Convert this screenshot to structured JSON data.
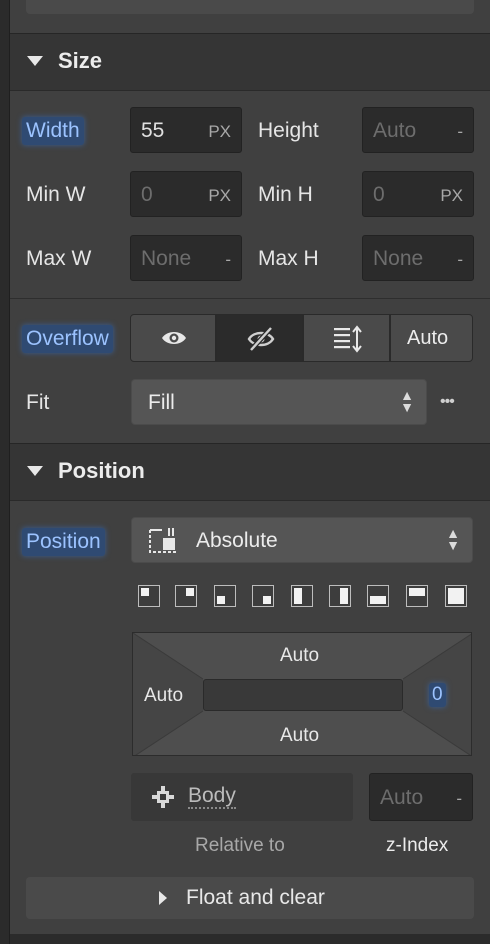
{
  "size": {
    "title": "Size",
    "width_label": "Width",
    "width_value": "55",
    "width_unit": "PX",
    "height_label": "Height",
    "height_value": "Auto",
    "height_unit": "-",
    "minw_label": "Min W",
    "minw_value": "0",
    "minw_unit": "PX",
    "minh_label": "Min H",
    "minh_value": "0",
    "minh_unit": "PX",
    "maxw_label": "Max W",
    "maxw_value": "None",
    "maxw_unit": "-",
    "maxh_label": "Max H",
    "maxh_value": "None",
    "maxh_unit": "-"
  },
  "overflow": {
    "label": "Overflow",
    "auto_label": "Auto",
    "selected": "hidden"
  },
  "fit": {
    "label": "Fit",
    "value": "Fill",
    "more": "•••"
  },
  "position": {
    "title": "Position",
    "label": "Position",
    "value": "Absolute",
    "top": "Auto",
    "left": "Auto",
    "right": "0",
    "bottom": "Auto",
    "relative_value": "Body",
    "relative_caption": "Relative to",
    "zindex_value": "Auto",
    "zindex_unit": "-",
    "zindex_caption": "z-Index"
  },
  "float": {
    "label": "Float and clear"
  },
  "colors": {
    "highlight": "#9cc3ff",
    "panel": "#404040",
    "input": "#2b2b2b"
  }
}
